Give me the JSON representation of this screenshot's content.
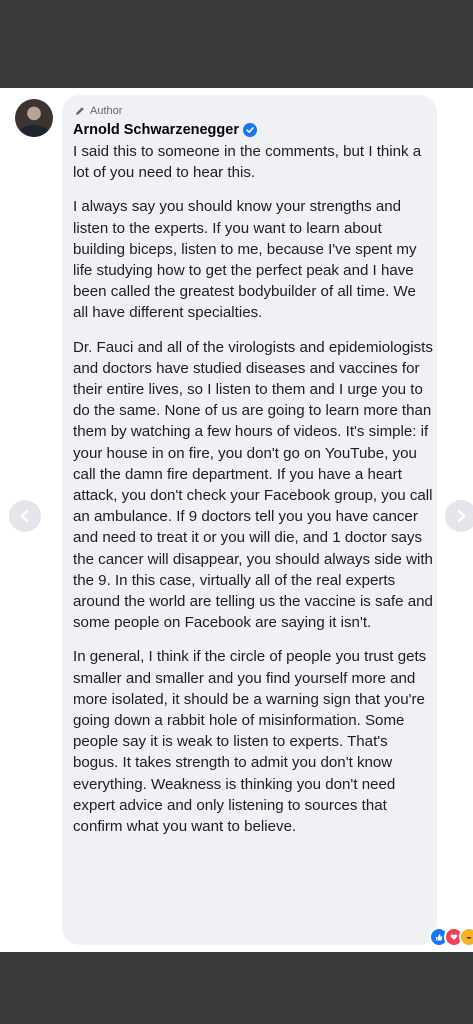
{
  "post": {
    "role_badge": "Author",
    "author_name": "Arnold Schwarzenegger",
    "paragraphs": [
      "I said this to someone in the comments, but I think a lot of you need to hear this.",
      "I always say you should know your strengths and listen to the experts. If you want to learn about building biceps, listen to me, because I've spent my life studying how to get the perfect peak and I have been called the greatest bodybuilder of all time. We all have different specialties.",
      "Dr. Fauci and all of the virologists and epidemiologists and doctors have studied diseases and vaccines for their entire lives, so I listen to them and I urge you to do the same. None of us are going to learn more than them by watching a few hours of videos. It's simple: if your house in on fire, you don't go on YouTube, you call the damn fire department. If you have a heart attack, you don't check your Facebook group, you call an ambulance. If 9 doctors tell you you have cancer and need to treat it or you will die, and 1 doctor says the cancer will disappear, you should always side with the 9. In this case, virtually all of the real experts around the world are telling us the vaccine is safe and some people on Facebook are saying it isn't.",
      "In general, I think if the circle of people you trust gets smaller and smaller and you find yourself more and more isolated, it should be a warning sign that you're going down a rabbit hole of misinformation. Some people say it is weak to listen to experts. That's bogus. It takes strength to admit you don't know everything. Weakness is thinking you don't need expert advice and only listening to sources that confirm what you want to believe."
    ]
  },
  "icons": {
    "role": "pencil-icon",
    "verified": "verified-badge-icon",
    "prev": "chevron-left-icon",
    "next": "chevron-right-icon",
    "reactions": [
      "like-icon",
      "love-icon",
      "haha-icon"
    ]
  },
  "colors": {
    "bubble": "#eff1f5",
    "frame": "#3a3b3c",
    "verified": "#1877f2",
    "like": "#1877f2",
    "love": "#f33e58",
    "haha": "#f7b125"
  }
}
